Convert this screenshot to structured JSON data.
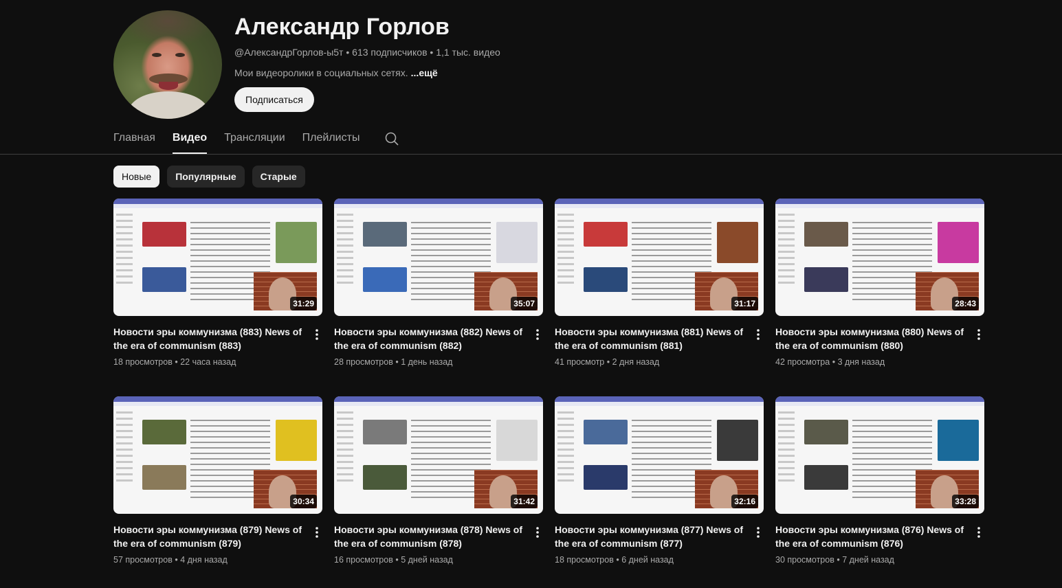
{
  "channel": {
    "name": "Александр Горлов",
    "handle": "@АлександрГорлов-ы5т",
    "subscribers": "613 подписчиков",
    "video_count": "1,1 тыс. видео",
    "separator": "•",
    "description": "Мои видеоролики в социальных сетях.",
    "more_label": "...ещё",
    "subscribe_label": "Подписаться"
  },
  "tabs": [
    {
      "label": "Главная",
      "active": false
    },
    {
      "label": "Видео",
      "active": true
    },
    {
      "label": "Трансляции",
      "active": false
    },
    {
      "label": "Плейлисты",
      "active": false
    }
  ],
  "chips": [
    {
      "label": "Новые",
      "active": true
    },
    {
      "label": "Популярные",
      "active": false
    },
    {
      "label": "Старые",
      "active": false
    }
  ],
  "videos": [
    {
      "title": "Новости эры коммунизма (883) News of the era of communism (883)",
      "views": "18 просмотров",
      "age": "22 часа назад",
      "duration": "31:29"
    },
    {
      "title": "Новости эры коммунизма (882) News of the era of communism (882)",
      "views": "28 просмотров",
      "age": "1 день назад",
      "duration": "35:07"
    },
    {
      "title": "Новости эры коммунизма (881) News of the era of communism (881)",
      "views": "41 просмотр",
      "age": "2 дня назад",
      "duration": "31:17"
    },
    {
      "title": "Новости эры коммунизма (880) News of the era of communism (880)",
      "views": "42 просмотра",
      "age": "3 дня назад",
      "duration": "28:43"
    },
    {
      "title": "Новости эры коммунизма (879) News of the era of communism (879)",
      "views": "57 просмотров",
      "age": "4 дня назад",
      "duration": "30:34"
    },
    {
      "title": "Новости эры коммунизма (878) News of the era of communism (878)",
      "views": "16 просмотров",
      "age": "5 дней назад",
      "duration": "31:42"
    },
    {
      "title": "Новости эры коммунизма (877) News of the era of communism (877)",
      "views": "18 просмотров",
      "age": "6 дней назад",
      "duration": "32:16"
    },
    {
      "title": "Новости эры коммунизма (876) News of the era of communism (876)",
      "views": "30 просмотров",
      "age": "7 дней назад",
      "duration": "33:28"
    }
  ],
  "icons": {
    "search": "search-icon",
    "kebab": "more-vert-icon"
  },
  "colors": {
    "background": "#0f0f0f",
    "text": "#f1f1f1",
    "secondary_text": "#aaaaaa",
    "chip_bg": "#272727",
    "subscribe_bg": "#f1f1f1"
  }
}
